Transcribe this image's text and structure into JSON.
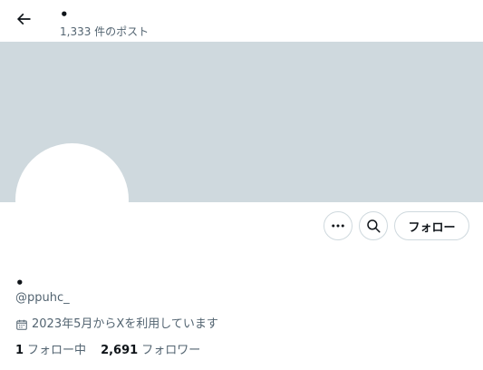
{
  "header": {
    "name": "•",
    "post_count": "1,333 件のポスト"
  },
  "profile": {
    "name": "•",
    "handle": "@ppuhc_",
    "joined": "2023年5月からXを利用しています"
  },
  "actions": {
    "follow_label": "フォロー"
  },
  "stats": {
    "following_count": "1",
    "following_label": "フォロー中",
    "followers_count": "2,691",
    "followers_label": "フォロワー"
  },
  "icons": {
    "back": "back-arrow-icon",
    "more": "more-icon",
    "search": "search-icon",
    "calendar": "calendar-icon"
  },
  "colors": {
    "banner": "#cfd9de",
    "secondary_text": "#536471",
    "primary_text": "#0f1419",
    "border": "#cfd9de"
  }
}
